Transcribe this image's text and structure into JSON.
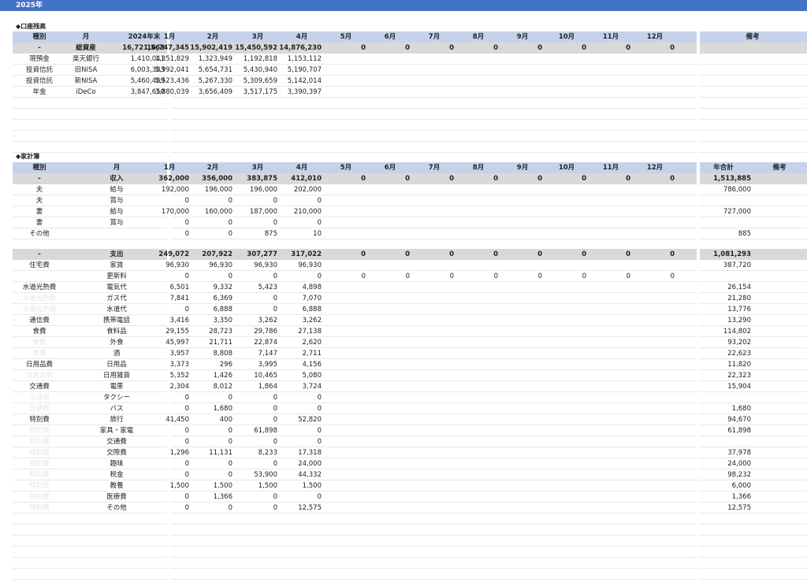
{
  "year_title": "2025年",
  "accounts": {
    "title": "◆口座残高",
    "headers": [
      "種別",
      "月",
      "2024年末",
      "1月",
      "2月",
      "3月",
      "4月",
      "5月",
      "6月",
      "7月",
      "8月",
      "9月",
      "10月",
      "11月",
      "12月",
      "備考"
    ],
    "total": [
      "-",
      "総資産",
      "16,721,563",
      "16,747,345",
      "15,902,419",
      "15,450,592",
      "14,876,230",
      "0",
      "0",
      "0",
      "0",
      "0",
      "0",
      "0",
      "0",
      ""
    ],
    "rows": [
      [
        "現預金",
        "楽天銀行",
        "1,410,041",
        "1,351,829",
        "1,323,949",
        "1,192,818",
        "1,153,112"
      ],
      [
        "投資信託",
        "旧NISA",
        "6,003,383",
        "5,992,041",
        "5,654,731",
        "5,430,940",
        "5,190,707"
      ],
      [
        "投資信託",
        "新NISA",
        "5,460,489",
        "5,523,436",
        "5,267,330",
        "5,309,659",
        "5,142,014"
      ],
      [
        "年金",
        "iDeCo",
        "3,847,650",
        "3,880,039",
        "3,656,409",
        "3,517,175",
        "3,390,397"
      ]
    ]
  },
  "ledger": {
    "title": "◆家計簿",
    "headers": [
      "種別",
      "月",
      "1月",
      "2月",
      "3月",
      "4月",
      "5月",
      "6月",
      "7月",
      "8月",
      "9月",
      "10月",
      "11月",
      "12月",
      "年合計",
      "備考"
    ],
    "income_total": [
      "-",
      "収入",
      "362,000",
      "356,000",
      "383,875",
      "412,010",
      "0",
      "0",
      "0",
      "0",
      "0",
      "0",
      "0",
      "0",
      "1,513,885"
    ],
    "income_rows": [
      [
        "夫",
        "給与",
        "192,000",
        "196,000",
        "196,000",
        "202,000",
        "786,000"
      ],
      [
        "夫",
        "賞与",
        "0",
        "0",
        "0",
        "0",
        ""
      ],
      [
        "妻",
        "給与",
        "170,000",
        "160,000",
        "187,000",
        "210,000",
        "727,000"
      ],
      [
        "妻",
        "賞与",
        "0",
        "0",
        "0",
        "0",
        ""
      ],
      [
        "その他",
        "",
        "0",
        "0",
        "875",
        "10",
        "885"
      ]
    ],
    "expense_total": [
      "-",
      "支出",
      "249,072",
      "207,922",
      "307,277",
      "317,022",
      "0",
      "0",
      "0",
      "0",
      "0",
      "0",
      "0",
      "0",
      "1,081,293"
    ],
    "expense_rows": [
      [
        "住宅費",
        "家賃",
        "96,930",
        "96,930",
        "96,930",
        "96,930",
        "387,720"
      ],
      [
        "",
        "更新料",
        "0",
        "0",
        "0",
        "0",
        ""
      ],
      [
        "水道光熱費",
        "電気代",
        "6,501",
        "9,332",
        "5,423",
        "4,898",
        "26,154"
      ],
      [
        "水道光熱費",
        "ガス代",
        "7,841",
        "6,369",
        "0",
        "7,070",
        "21,280"
      ],
      [
        "水道光熱費",
        "水道代",
        "0",
        "6,888",
        "0",
        "6,888",
        "13,776"
      ],
      [
        "通信費",
        "携帯電話",
        "3,416",
        "3,350",
        "3,262",
        "3,262",
        "13,290"
      ],
      [
        "食費",
        "食料品",
        "29,155",
        "28,723",
        "29,786",
        "27,138",
        "114,802"
      ],
      [
        "食費",
        "外食",
        "45,997",
        "21,711",
        "22,874",
        "2,620",
        "93,202"
      ],
      [
        "食費",
        "酒",
        "3,957",
        "8,808",
        "7,147",
        "2,711",
        "22,623"
      ],
      [
        "日用品費",
        "日用品",
        "3,373",
        "296",
        "3,995",
        "4,156",
        "11,820"
      ],
      [
        "日用品費",
        "日用雑貨",
        "5,352",
        "1,426",
        "10,465",
        "5,080",
        "22,323"
      ],
      [
        "交通費",
        "電車",
        "2,304",
        "8,012",
        "1,864",
        "3,724",
        "15,904"
      ],
      [
        "交通費",
        "タクシー",
        "0",
        "0",
        "0",
        "0",
        ""
      ],
      [
        "交通費",
        "バス",
        "0",
        "1,680",
        "0",
        "0",
        "1,680"
      ],
      [
        "特別費",
        "旅行",
        "41,450",
        "400",
        "0",
        "52,820",
        "94,670"
      ],
      [
        "特別費",
        "家具・家電",
        "0",
        "0",
        "61,898",
        "0",
        "61,898"
      ],
      [
        "特別費",
        "交通費",
        "0",
        "0",
        "0",
        "0",
        ""
      ],
      [
        "特別費",
        "交際費",
        "1,296",
        "11,131",
        "8,233",
        "17,318",
        "37,978"
      ],
      [
        "特別費",
        "趣味",
        "0",
        "0",
        "0",
        "24,000",
        "24,000"
      ],
      [
        "特別費",
        "税金",
        "0",
        "0",
        "53,900",
        "44,332",
        "98,232"
      ],
      [
        "特別費",
        "教養",
        "1,500",
        "1,500",
        "1,500",
        "1,500",
        "6,000"
      ],
      [
        "特別費",
        "医療費",
        "0",
        "1,366",
        "0",
        "0",
        "1,366"
      ],
      [
        "特別費",
        "その他",
        "0",
        "0",
        "0",
        "12,575",
        "12,575"
      ]
    ],
    "renewal_future": [
      "0",
      "0",
      "0",
      "0",
      "0",
      "0",
      "0",
      "0"
    ]
  }
}
